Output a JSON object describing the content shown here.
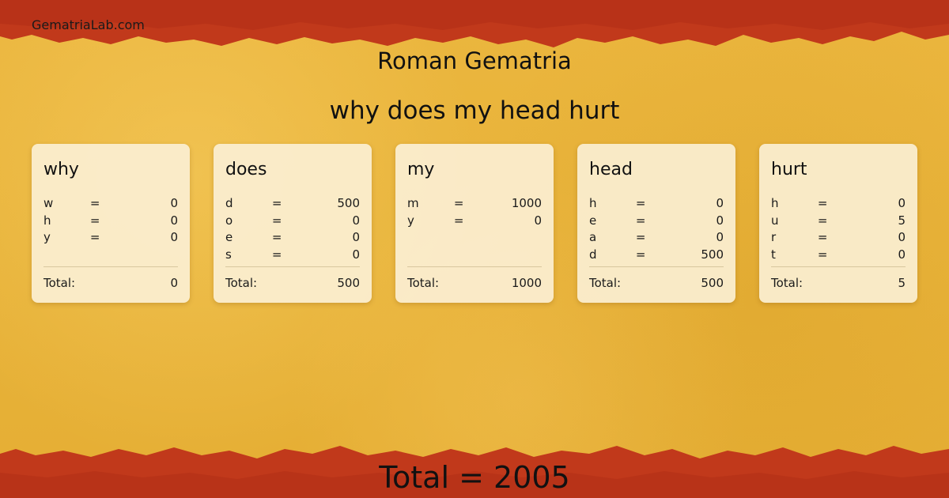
{
  "site": {
    "name": "GematriaLab.com"
  },
  "page": {
    "title": "Roman Gematria",
    "phrase": "why does my head hurt"
  },
  "colors": {
    "background": "#e9b53c",
    "band": "#c1391b",
    "card": "#fbefd2"
  },
  "words": [
    {
      "word": "why",
      "letters": [
        {
          "ch": "w",
          "eq": "=",
          "val": "0"
        },
        {
          "ch": "h",
          "eq": "=",
          "val": "0"
        },
        {
          "ch": "y",
          "eq": "=",
          "val": "0"
        }
      ],
      "total_label": "Total:",
      "total": "0"
    },
    {
      "word": "does",
      "letters": [
        {
          "ch": "d",
          "eq": "=",
          "val": "500"
        },
        {
          "ch": "o",
          "eq": "=",
          "val": "0"
        },
        {
          "ch": "e",
          "eq": "=",
          "val": "0"
        },
        {
          "ch": "s",
          "eq": "=",
          "val": "0"
        }
      ],
      "total_label": "Total:",
      "total": "500"
    },
    {
      "word": "my",
      "letters": [
        {
          "ch": "m",
          "eq": "=",
          "val": "1000"
        },
        {
          "ch": "y",
          "eq": "=",
          "val": "0"
        }
      ],
      "total_label": "Total:",
      "total": "1000"
    },
    {
      "word": "head",
      "letters": [
        {
          "ch": "h",
          "eq": "=",
          "val": "0"
        },
        {
          "ch": "e",
          "eq": "=",
          "val": "0"
        },
        {
          "ch": "a",
          "eq": "=",
          "val": "0"
        },
        {
          "ch": "d",
          "eq": "=",
          "val": "500"
        }
      ],
      "total_label": "Total:",
      "total": "500"
    },
    {
      "word": "hurt",
      "letters": [
        {
          "ch": "h",
          "eq": "=",
          "val": "0"
        },
        {
          "ch": "u",
          "eq": "=",
          "val": "5"
        },
        {
          "ch": "r",
          "eq": "=",
          "val": "0"
        },
        {
          "ch": "t",
          "eq": "=",
          "val": "0"
        }
      ],
      "total_label": "Total:",
      "total": "5"
    }
  ],
  "grand_total": "Total = 2005"
}
